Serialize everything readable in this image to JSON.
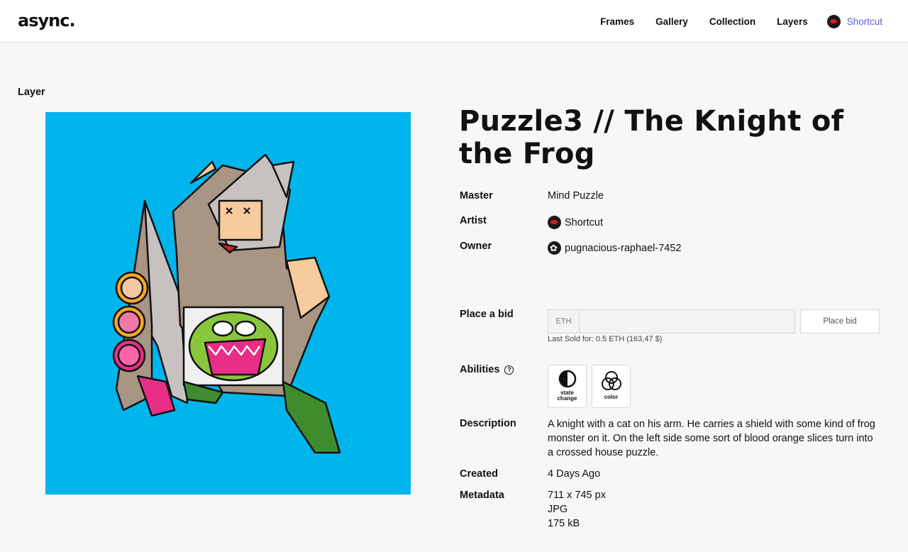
{
  "header": {
    "logo": "async.",
    "nav": [
      "Frames",
      "Gallery",
      "Collection",
      "Layers"
    ],
    "user": "Shortcut"
  },
  "section_label": "Layer",
  "title": "Puzzle3 // The Knight of the Frog",
  "details": {
    "master_label": "Master",
    "master_value": "Mind Puzzle",
    "artist_label": "Artist",
    "artist_value": "Shortcut",
    "owner_label": "Owner",
    "owner_value": "pugnacious-raphael-7452"
  },
  "bid": {
    "label": "Place a bid",
    "currency": "ETH",
    "input_value": "",
    "button": "Place bid",
    "last_sold": "Last Sold for: 0.5 ETH (163,47 $)"
  },
  "abilities": {
    "label": "Abilities",
    "help": "?",
    "items": [
      {
        "label_line1": "state",
        "label_line2": "change",
        "icon": "half-circle-icon"
      },
      {
        "label_line1": "color",
        "label_line2": "",
        "icon": "color-circles-icon"
      }
    ]
  },
  "description": {
    "label": "Description",
    "text": "A knight with a cat on his arm. He carries a shield with some kind of frog monster on it. On the left side some sort of blood orange slices turn into a crossed house puzzle."
  },
  "created": {
    "label": "Created",
    "value": "4 Days Ago"
  },
  "metadata": {
    "label": "Metadata",
    "dimensions": "711 x 745 px",
    "format": "JPG",
    "size": "175 kB"
  },
  "colors": {
    "artwork_background": "#00b4ec",
    "user_link": "#5560d6"
  }
}
